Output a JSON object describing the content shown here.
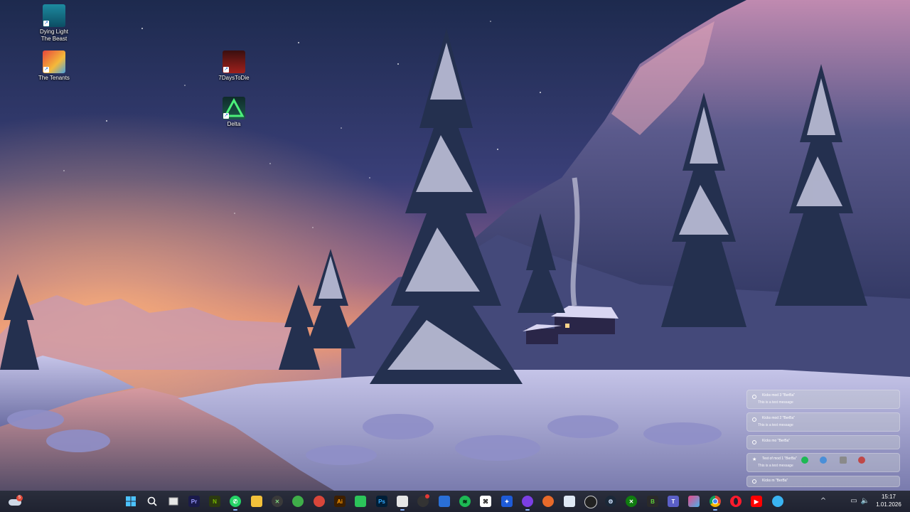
{
  "desktop": {
    "icons": [
      {
        "label_line1": "Dying Light",
        "label_line2": "The Beast",
        "icon": "dying-light-icon"
      },
      {
        "label_line1": "The Tenants",
        "label_line2": "",
        "icon": "the-tenants-icon"
      },
      {
        "label_line1": "7DaysToDie",
        "label_line2": "",
        "icon": "7-days-to-die-icon"
      },
      {
        "label_line1": "Delta",
        "label_line2": "",
        "icon": "delta-icon"
      }
    ]
  },
  "notifications": [
    {
      "title": "Kicks mod 3 \"BerBa\"",
      "message": "This is a test message"
    },
    {
      "title": "Kicks mod 2 \"BerBa\"",
      "message": "This is a test message"
    },
    {
      "title": "Kicks mo \"BerBa\"",
      "message": ""
    },
    {
      "title": "Test of mod 1 \"BerBa\"",
      "message": "This is a test message"
    },
    {
      "title": "Kicks m \"BerBa\"",
      "message": ""
    }
  ],
  "taskbar": {
    "weather_badge": "5",
    "apps": [
      "start-icon",
      "search-icon",
      "task-view-icon",
      "premiere-pro-icon",
      "nvidia-icon",
      "whatsapp-icon",
      "file-explorer-icon",
      "xbox-icon",
      "app-green-icon",
      "app-red-icon",
      "illustrator-icon",
      "app-green2-icon",
      "photoshop-icon",
      "app-doc-icon",
      "app-red-dot-icon",
      "app-blue-icon",
      "spotify-icon",
      "capcut-icon",
      "app-dots-icon",
      "app-purple-icon",
      "app-orange-icon",
      "app-window-icon",
      "obs-icon",
      "steam-icon",
      "xbox-app-icon",
      "bitdefender-icon",
      "teams-icon",
      "app-multi-icon",
      "chrome-icon",
      "opera-icon",
      "youtube-icon",
      "app-cyan-icon"
    ],
    "colors": {
      "accent": "#8ab4ff"
    }
  },
  "tray": {
    "chevron": "^",
    "network_icon": "network-icon",
    "volume_icon": "volume-icon"
  },
  "clock": {
    "time": "15:17",
    "date": "1.01.2026"
  }
}
